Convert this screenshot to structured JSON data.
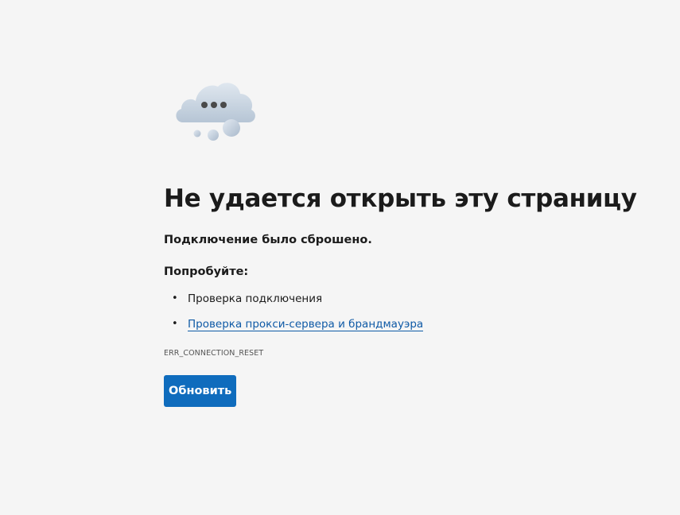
{
  "error_page": {
    "title": "Не удается открыть эту страницу",
    "subtitle": "Подключение было сброшено.",
    "try_heading": "Попробуйте:",
    "suggestions": [
      {
        "label": "Проверка подключения",
        "is_link": false
      },
      {
        "label": "Проверка прокси-сервера и брандмауэра",
        "is_link": true
      }
    ],
    "bullet": "•",
    "error_code": "ERR_CONNECTION_RESET",
    "reload_label": "Обновить"
  },
  "illustration": {
    "icon": "cloud-dots-icon",
    "colors": {
      "cloud": "#c9d6e3",
      "cloud_shadow": "#a9b9cb",
      "dots": "#4a4a4a"
    }
  },
  "colors": {
    "background": "#f5f5f5",
    "text": "#1b1b1b",
    "link": "#0f5aa6",
    "button": "#0f6cbd",
    "button_text": "#ffffff"
  }
}
